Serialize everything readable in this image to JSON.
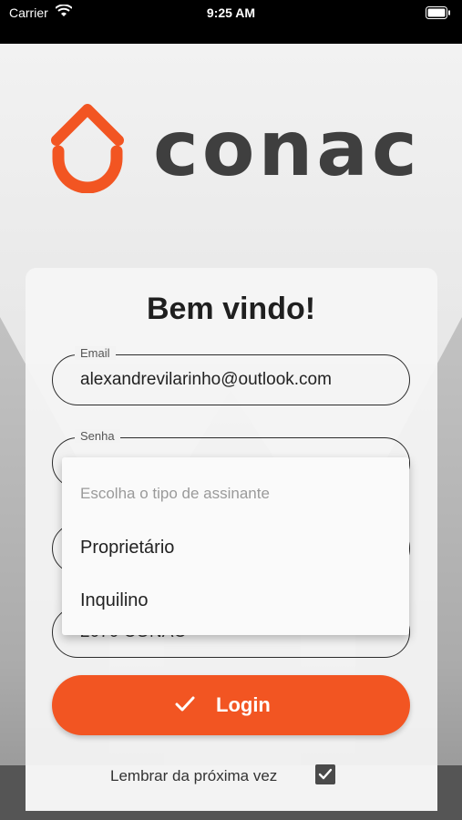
{
  "status_bar": {
    "carrier": "Carrier",
    "time": "9:25 AM"
  },
  "logo": {
    "text": "conac",
    "color": "#f25522"
  },
  "card": {
    "title": "Bem vindo!"
  },
  "form": {
    "email_label": "Email",
    "email_value": "alexandrevilarinho@outlook.com",
    "senha_label": "Senha",
    "partial_value": "2070 CONAC"
  },
  "dropdown": {
    "placeholder": "Escolha o tipo de assinante",
    "options": [
      "Proprietário",
      "Inquilino"
    ]
  },
  "login_button": {
    "label": "Login",
    "color": "#f25522"
  },
  "remember": {
    "label": "Lembrar da próxima vez",
    "checked": true
  }
}
